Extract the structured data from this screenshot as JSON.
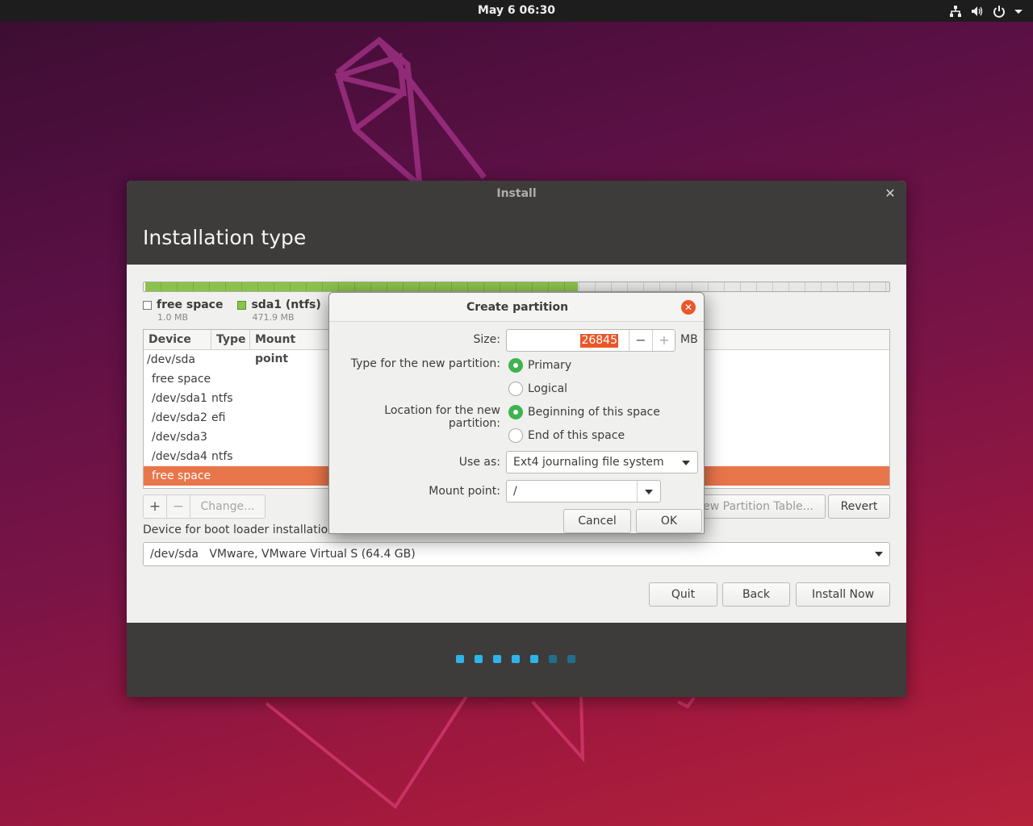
{
  "topbar": {
    "clock": "May 6  06:30",
    "icons": [
      "network-icon",
      "volume-icon",
      "power-icon",
      "menu-arrow-icon"
    ]
  },
  "window": {
    "title": "Install",
    "heading": "Installation type"
  },
  "disk": {
    "segments": [
      {
        "name": "free space",
        "color": "#ffffff",
        "fraction": 0.0002
      },
      {
        "name": "sda1 (ntfs)",
        "color": "#8bc34a",
        "fraction": 0.58
      },
      {
        "name": "free space",
        "color": "#e7e7e5",
        "fraction": 0.42
      }
    ],
    "legend": [
      {
        "label": "free space",
        "size": "1.0 MB",
        "color": "#ffffff"
      },
      {
        "label": "sda1 (ntfs)",
        "size": "471.9 MB",
        "color": "#8bc34a"
      },
      {
        "label": "",
        "size": "",
        "color": "#e9722a"
      }
    ]
  },
  "table": {
    "headers": [
      "Device",
      "Type",
      "Mount point"
    ],
    "rows": [
      {
        "device": "/dev/sda",
        "type": ""
      },
      {
        "device": "free space",
        "type": ""
      },
      {
        "device": "/dev/sda1",
        "type": "ntfs"
      },
      {
        "device": "/dev/sda2",
        "type": "efi"
      },
      {
        "device": "/dev/sda3",
        "type": ""
      },
      {
        "device": "/dev/sda4",
        "type": "ntfs"
      },
      {
        "device": "free space",
        "type": ""
      }
    ]
  },
  "tools": {
    "add": "+",
    "remove": "−",
    "change": "Change..."
  },
  "buttons": {
    "new_table": "ew Partition Table...",
    "revert": "Revert",
    "quit": "Quit",
    "back": "Back",
    "install": "Install Now"
  },
  "boot": {
    "label": "Device for boot loader installation:",
    "device": "/dev/sda",
    "description": "VMware, VMware Virtual S (64.4 GB)"
  },
  "progress": {
    "total": 7,
    "active": 5,
    "active_color": "#2fb3ea",
    "inactive_color": "#1f6f8b"
  },
  "dialog": {
    "title": "Create partition",
    "size_label": "Size:",
    "size_value": "26845",
    "size_unit": "MB",
    "minus": "−",
    "plus": "+",
    "type_label": "Type for the new partition:",
    "type_primary": "Primary",
    "type_logical": "Logical",
    "location_label": "Location for the new partition:",
    "location_beginning": "Beginning of this space",
    "location_end": "End of this space",
    "use_as_label": "Use as:",
    "use_as_value": "Ext4 journaling file system",
    "mount_label": "Mount point:",
    "mount_value": "/",
    "cancel": "Cancel",
    "ok": "OK"
  }
}
